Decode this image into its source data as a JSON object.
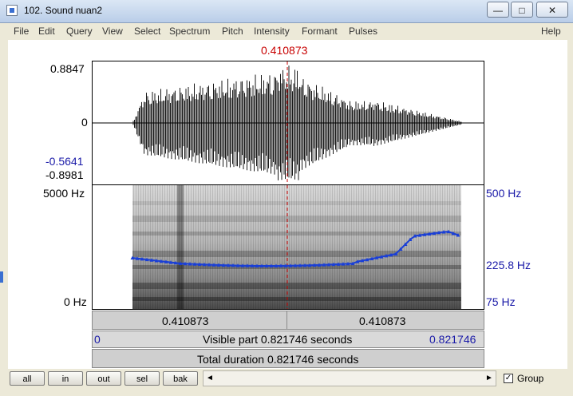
{
  "window": {
    "title": "102. Sound nuan2",
    "minimize_glyph": "—",
    "maximize_glyph": "□",
    "close_glyph": "✕"
  },
  "menu": [
    "File",
    "Edit",
    "Query",
    "View",
    "Select",
    "Spectrum",
    "Pitch",
    "Intensity",
    "Formant",
    "Pulses"
  ],
  "help_label": "Help",
  "cursor_time": "0.410873",
  "waveform": {
    "y_max": "0.8847",
    "y_zero": "0",
    "y_cursor_value": "-0.5641",
    "y_min": "-0.8981"
  },
  "spectrogram": {
    "freq_max": "5000 Hz",
    "freq_min": "0 Hz",
    "pitch_max": "500 Hz",
    "pitch_cursor": "225.8 Hz",
    "pitch_min": "75 Hz"
  },
  "selection_bar": {
    "left_time": "0.410873",
    "right_time": "0.410873"
  },
  "visible_bar": {
    "start": "0",
    "label": "Visible part 0.821746 seconds",
    "end": "0.821746"
  },
  "total_bar": {
    "label": "Total duration 0.821746 seconds"
  },
  "buttons": [
    "all",
    "in",
    "out",
    "sel",
    "bak"
  ],
  "scroll": {
    "left_arrow": "◄",
    "right_arrow": "►"
  },
  "group": {
    "label": "Group",
    "checked_glyph": "✓"
  },
  "colors": {
    "cursor_red": "#c80000",
    "pitch_blue": "#1a3fd6",
    "axis_blue": "#1a1aa8"
  }
}
